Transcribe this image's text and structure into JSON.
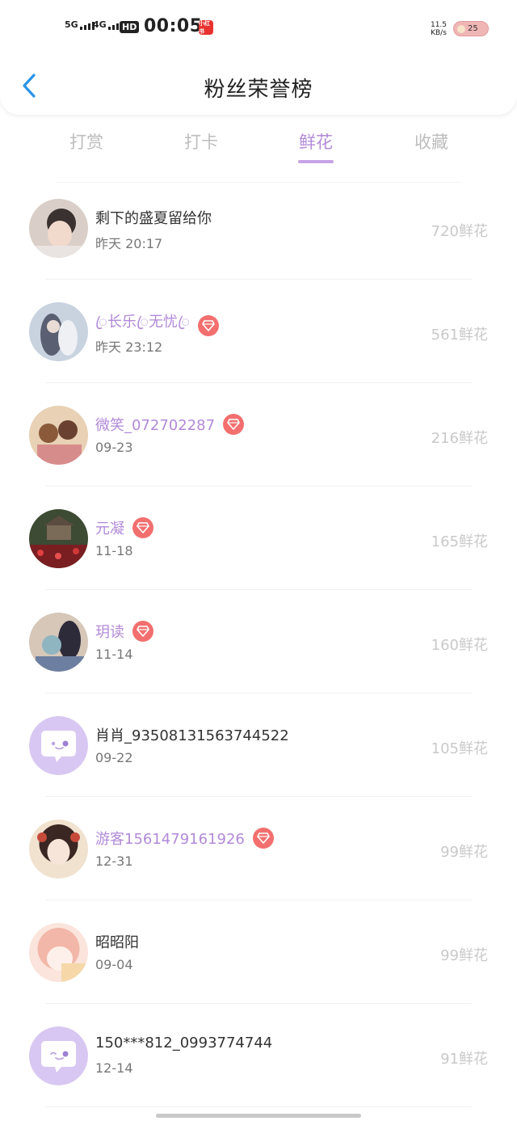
{
  "status_bar": {
    "signal1": "5G",
    "signal2": "4G",
    "hd_badge": "HD",
    "time": "00:05",
    "app_label": "小红书",
    "speed_value": "11.5",
    "speed_unit": "KB/s",
    "battery": "25"
  },
  "header": {
    "title": "粉丝荣誉榜"
  },
  "tabs": [
    {
      "label": "打赏"
    },
    {
      "label": "打卡"
    },
    {
      "label": "鲜花"
    },
    {
      "label": "收藏"
    }
  ],
  "active_tab": "鲜花",
  "list": [
    {
      "name": "剩下的盛夏留给你",
      "time": "昨天 20:17",
      "amount": "720鲜花",
      "vip": false
    },
    {
      "name": "ꦿ长乐ꦿ无忧ꦿ",
      "time": "昨天 23:12",
      "amount": "561鲜花",
      "vip": true
    },
    {
      "name": "微笑_072702287",
      "time": "09-23",
      "amount": "216鲜花",
      "vip": true
    },
    {
      "name": "元凝",
      "time": "11-18",
      "amount": "165鲜花",
      "vip": true
    },
    {
      "name": "玥读",
      "time": "11-14",
      "amount": "160鲜花",
      "vip": true
    },
    {
      "name": "肖肖_93508131563744522",
      "time": "09-22",
      "amount": "105鲜花",
      "vip": false
    },
    {
      "name": "游客1561479161926",
      "time": "12-31",
      "amount": "99鲜花",
      "vip": true
    },
    {
      "name": "昭昭阳",
      "time": "09-04",
      "amount": "99鲜花",
      "vip": false
    },
    {
      "name": "150***812_0993774744",
      "time": "12-14",
      "amount": "91鲜花",
      "vip": false
    }
  ],
  "colors": {
    "accent": "#b28ad8",
    "badge": "#f36f6f",
    "back_arrow": "#2a93e6"
  }
}
